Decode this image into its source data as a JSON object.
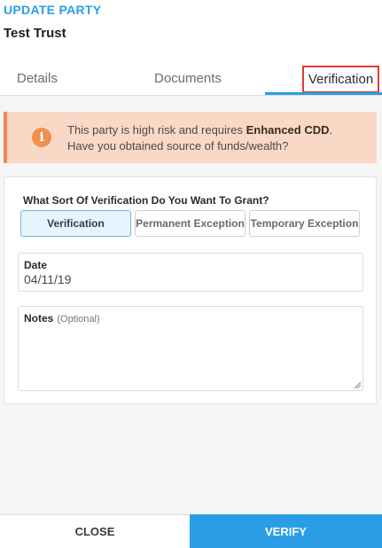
{
  "header": {
    "eyebrow": "UPDATE PARTY",
    "title": "Test Trust"
  },
  "tabs": [
    {
      "label": "Details",
      "active": false
    },
    {
      "label": "Documents",
      "active": false
    },
    {
      "label": "Verification",
      "active": true
    }
  ],
  "alert": {
    "icon": "info-icon",
    "text_before": "This party is high risk and requires ",
    "text_bold": "Enhanced CDD",
    "text_after": ".",
    "line2": "Have you obtained source of funds/wealth?"
  },
  "form": {
    "question": "What Sort Of Verification Do You Want To Grant?",
    "options": [
      {
        "label": "Verification",
        "selected": true
      },
      {
        "label": "Permanent Exception",
        "selected": false
      },
      {
        "label": "Temporary Exception",
        "selected": false
      }
    ],
    "date": {
      "label": "Date",
      "value": "04/11/19"
    },
    "notes": {
      "label": "Notes",
      "optional": "(Optional)",
      "value": ""
    }
  },
  "footer": {
    "close_label": "CLOSE",
    "verify_label": "VERIFY"
  },
  "colors": {
    "accent": "#2a9ee4",
    "alert_bg": "#f9d9c6",
    "alert_icon": "#f0904f",
    "highlight_border": "#e53935"
  }
}
